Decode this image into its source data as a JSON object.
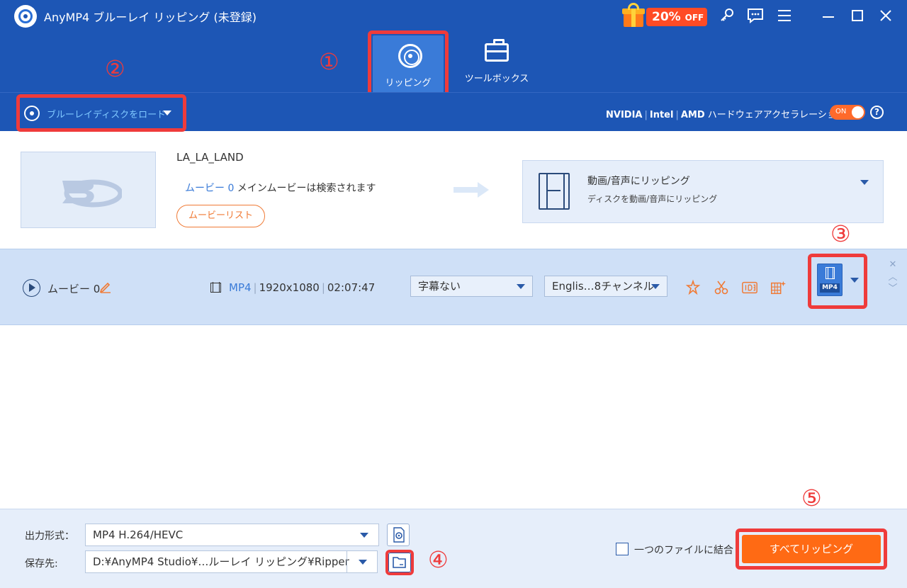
{
  "app": {
    "title": "AnyMP4 ブルーレイ リッピング (未登録)"
  },
  "promo": {
    "percent": "20%",
    "off": "OFF",
    "color": "#ff4b25"
  },
  "window_icons": [
    "key-icon",
    "feedback-icon",
    "menu-icon",
    "minimize-icon",
    "maximize-icon",
    "close-icon"
  ],
  "tabs": [
    {
      "label": "リッピング",
      "icon": "disc-icon",
      "active": true
    },
    {
      "label": "ツールボックス",
      "icon": "toolbox-icon",
      "active": false
    }
  ],
  "callouts": {
    "c1": "①",
    "c2": "②",
    "c3": "③",
    "c4": "④",
    "c5": "⑤",
    "color": "#ef3b3b"
  },
  "load": {
    "label": "ブルーレイディスクをロード",
    "icon": "disc-load-icon"
  },
  "hw": {
    "nvidia": "NVIDIA",
    "intel": "Intel",
    "amd": "AMD",
    "label": "ハードウェアアクセラレーション",
    "toggle": "ON",
    "help": "?"
  },
  "source": {
    "disc_title": "LA_LA_LAND",
    "movie_link": "ムービー 0",
    "movie_text": " メインムービーは検索されます",
    "movie_list_button": "ムービーリスト"
  },
  "output": {
    "title": "動画/音声にリッピング",
    "subtitle": "ディスクを動画/音声にリッピング"
  },
  "title_row": {
    "name": "ムービー 0",
    "format": "MP4",
    "resolution": "1920x1080",
    "duration": "02:07:47",
    "subtitle_select": "字幕ない",
    "audio_select": "Englis…8チャンネル",
    "tools": [
      "enhance-icon",
      "cut-icon",
      "id3-icon",
      "edit-effects-icon"
    ],
    "output_format_icon_label": "MP4"
  },
  "bottom": {
    "format_label": "出力形式：",
    "format_value": "MP4 H.264/HEVC",
    "dest_label": "保存先:",
    "dest_value": "D:¥AnyMP4 Studio¥…ルーレイ リッピング¥Ripper",
    "merge_label": "一つのファイルに結合",
    "rip_all": "すべてリッピング"
  },
  "colors": {
    "header": "#1d56b5",
    "accent": "#ff6a14",
    "highlight": "#ef3b3b",
    "link": "#3a7bd8"
  }
}
